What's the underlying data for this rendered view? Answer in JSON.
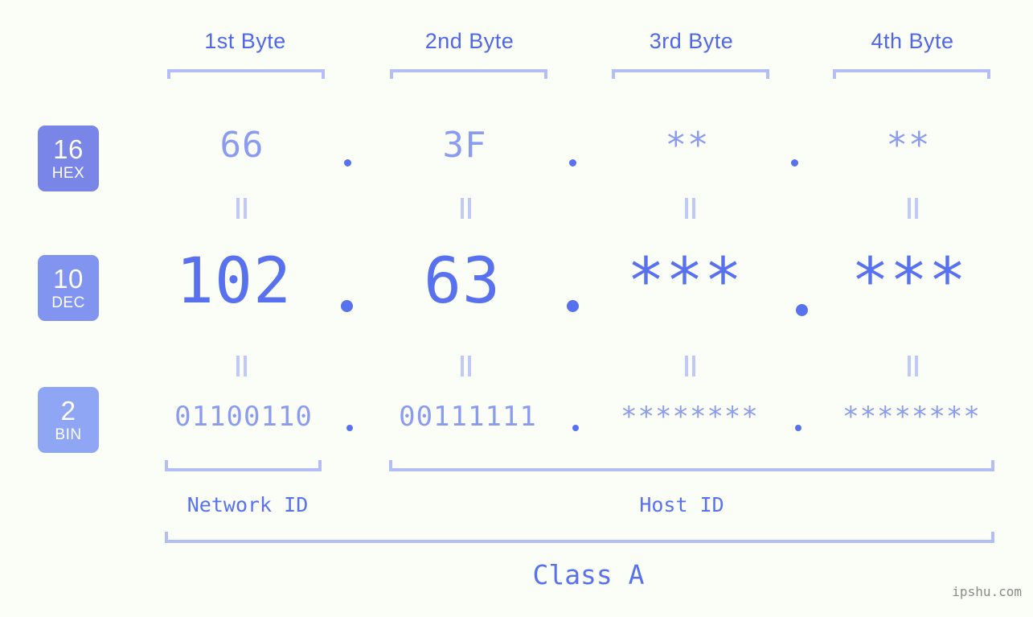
{
  "page": {
    "background_color": "#fbfdf7",
    "accent_color": "#5871ee",
    "light_accent_color": "#b3bdf7",
    "watermark": "ipshu.com"
  },
  "byte_headers": [
    {
      "label": "1st Byte"
    },
    {
      "label": "2nd Byte"
    },
    {
      "label": "3rd Byte"
    },
    {
      "label": "4th Byte"
    }
  ],
  "bases": [
    {
      "num": "16",
      "name": "HEX",
      "color": "#7986e8"
    },
    {
      "num": "10",
      "name": "DEC",
      "color": "#8194f0"
    },
    {
      "num": "2",
      "name": "BIN",
      "color": "#8fa6f5"
    }
  ],
  "rows": {
    "hex": {
      "values": [
        "66",
        "3F",
        "**",
        "**"
      ],
      "separator": "."
    },
    "dec": {
      "values": [
        "102",
        "63",
        "***",
        "***"
      ],
      "separator": "."
    },
    "bin": {
      "values": [
        "01100110",
        "00111111",
        "********",
        "********"
      ],
      "separator": "."
    }
  },
  "equality_symbol": "||",
  "segments": {
    "network_id": "Network ID",
    "host_id": "Host ID",
    "class": "Class A"
  },
  "chart_data": {
    "type": "table",
    "title": "IP Address Byte Breakdown",
    "columns": [
      "1st Byte",
      "2nd Byte",
      "3rd Byte",
      "4th Byte"
    ],
    "rows": [
      {
        "base": "16",
        "base_name": "HEX",
        "values": [
          "66",
          "3F",
          "**",
          "**"
        ]
      },
      {
        "base": "10",
        "base_name": "DEC",
        "values": [
          "102",
          "63",
          "***",
          "***"
        ]
      },
      {
        "base": "2",
        "base_name": "BIN",
        "values": [
          "01100110",
          "00111111",
          "********",
          "********"
        ]
      }
    ],
    "network_id_bytes": [
      1
    ],
    "host_id_bytes": [
      2,
      3,
      4
    ],
    "address_class": "Class A"
  }
}
